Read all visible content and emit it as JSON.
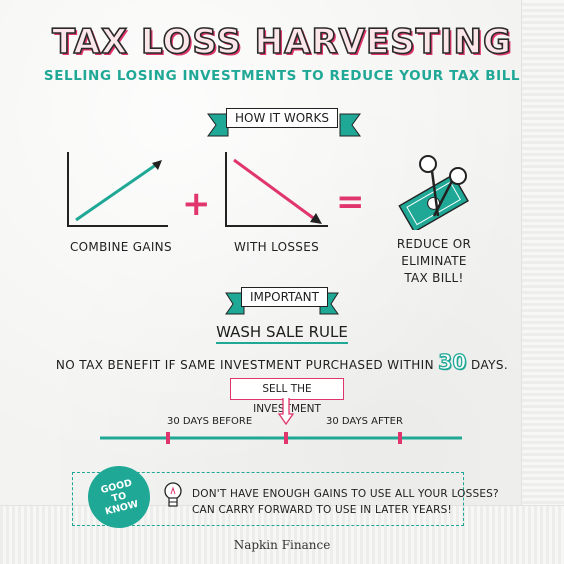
{
  "header": {
    "title": "TAX LOSS HARVESTING",
    "subtitle": "SELLING LOSING INVESTMENTS TO REDUCE YOUR TAX BILL"
  },
  "how_it_works": {
    "banner": "HOW IT WORKS",
    "step1_label": "COMBINE GAINS",
    "plus": "+",
    "step2_label": "WITH LOSSES",
    "equals": "=",
    "result_line1": "REDUCE OR ELIMINATE",
    "result_line2": "TAX BILL!"
  },
  "important": {
    "banner": "IMPORTANT",
    "rule_title": "WASH SALE RULE",
    "rule_text_before": "NO TAX BENEFIT IF SAME INVESTMENT PURCHASED WITHIN",
    "rule_days": "30",
    "rule_text_after": "DAYS."
  },
  "timeline": {
    "sell_label": "SELL THE INVESTMENT",
    "before_label": "30 DAYS BEFORE",
    "after_label": "30 DAYS AFTER"
  },
  "good_to_know": {
    "badge_line1": "GOOD",
    "badge_line2": "TO",
    "badge_line3": "KNOW",
    "line1": "DON'T HAVE ENOUGH GAINS TO USE ALL YOUR LOSSES?",
    "line2": "CAN CARRY FORWARD TO USE IN LATER YEARS!"
  },
  "footer": {
    "brand": "Napkin Finance"
  },
  "colors": {
    "teal": "#1fa896",
    "pink": "#e0356d",
    "ink": "#1e1e1e",
    "napkin": "#f3f3f1"
  }
}
